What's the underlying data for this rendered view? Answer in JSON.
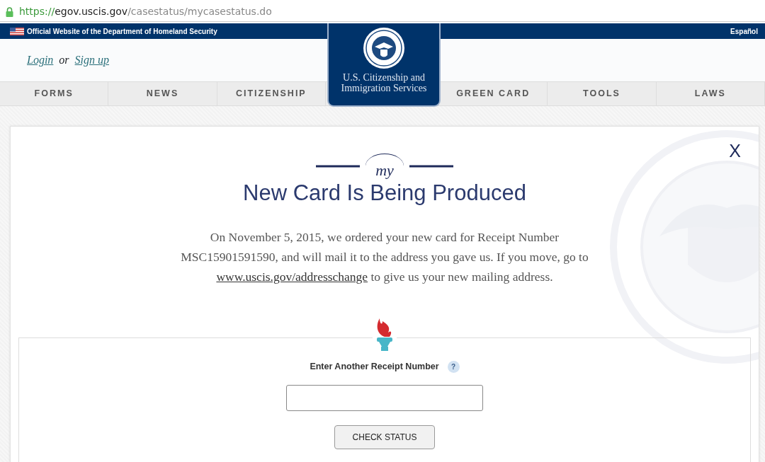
{
  "browser": {
    "url_scheme": "https://",
    "url_host": "egov.uscis.gov",
    "url_path": "/casestatus/mycasestatus.do"
  },
  "top_bar": {
    "official_text": "Official Website of the Department of Homeland Security",
    "language_link": "Español"
  },
  "account": {
    "login": "Login",
    "separator": "or",
    "signup": "Sign up"
  },
  "agency_logo": {
    "line_1": "U.S. Citizenship and",
    "line_2": "Immigration Services"
  },
  "nav": [
    {
      "label": "FORMS"
    },
    {
      "label": "NEWS"
    },
    {
      "label": "CITIZENSHIP"
    },
    {
      "label": "GREEN CARD"
    },
    {
      "label": "TOOLS"
    },
    {
      "label": "LAWS"
    }
  ],
  "status": {
    "logo_mark": "my",
    "close": "X",
    "title": "New Card Is Being Produced",
    "message_before": "On November 5, 2015, we ordered your new card for Receipt Number MSC15901591590, and will mail it to the address you gave us. If you move, go to",
    "message_link": "www.uscis.gov/addresschange",
    "message_after": "to give us your new mailing address."
  },
  "lookup": {
    "label": "Enter Another Receipt Number",
    "help": "?",
    "button": "CHECK STATUS"
  }
}
